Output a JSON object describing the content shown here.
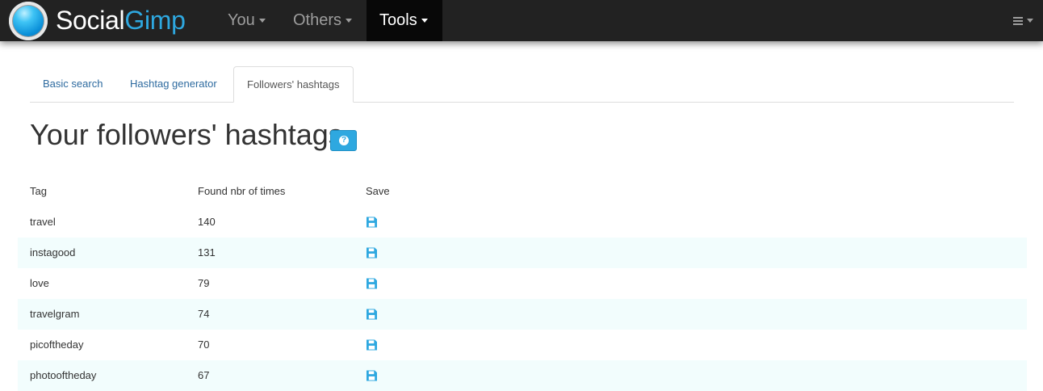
{
  "navbar": {
    "brand_part1": "Social",
    "brand_part2": "Gimp",
    "items": [
      {
        "label": "You"
      },
      {
        "label": "Others"
      },
      {
        "label": "Tools"
      }
    ]
  },
  "tabs": [
    {
      "label": "Basic search"
    },
    {
      "label": "Hashtag generator"
    },
    {
      "label": "Followers' hashtags"
    }
  ],
  "page": {
    "title": "Your followers' hashtags",
    "help_icon": "question-circle-icon"
  },
  "table": {
    "headers": [
      "Tag",
      "Found nbr of times",
      "Save"
    ],
    "save_icon": "floppy-disk-icon",
    "rows": [
      {
        "tag": "travel",
        "count": "140"
      },
      {
        "tag": "instagood",
        "count": "131"
      },
      {
        "tag": "love",
        "count": "79"
      },
      {
        "tag": "travelgram",
        "count": "74"
      },
      {
        "tag": "picoftheday",
        "count": "70"
      },
      {
        "tag": "photooftheday",
        "count": "67"
      }
    ]
  },
  "colors": {
    "navbar": "#222222",
    "accent": "#2ea8e0",
    "stripe": "#f2fdfd",
    "link": "#2d6a9f"
  }
}
